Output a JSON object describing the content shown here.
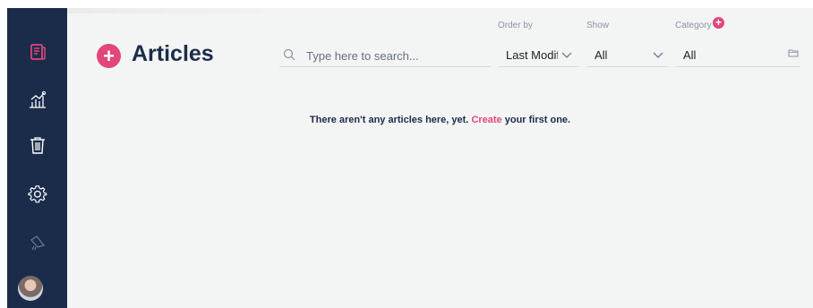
{
  "header": {
    "title": "Articles",
    "add_symbol": "+"
  },
  "search": {
    "placeholder": "Type here to search...",
    "value": ""
  },
  "filters": {
    "order_by": {
      "label": "Order by",
      "value": "Last Modif"
    },
    "show": {
      "label": "Show",
      "value": "All"
    },
    "category": {
      "label": "Category",
      "value": "All",
      "add_symbol": "+"
    }
  },
  "empty_state": {
    "prefix": "There aren't any articles here, yet.",
    "link": "Create",
    "suffix": "your first one."
  },
  "sidebar": {
    "items": [
      {
        "icon": "articles-icon"
      },
      {
        "icon": "analytics-icon"
      },
      {
        "icon": "trash-icon"
      },
      {
        "icon": "settings-icon"
      },
      {
        "icon": "megaphone-icon"
      }
    ],
    "avatar": "avatar"
  },
  "colors": {
    "sidebar": "#1b2c4b",
    "accent": "#e0477a",
    "background": "#f3f4f4",
    "title": "#1b2c4b"
  }
}
